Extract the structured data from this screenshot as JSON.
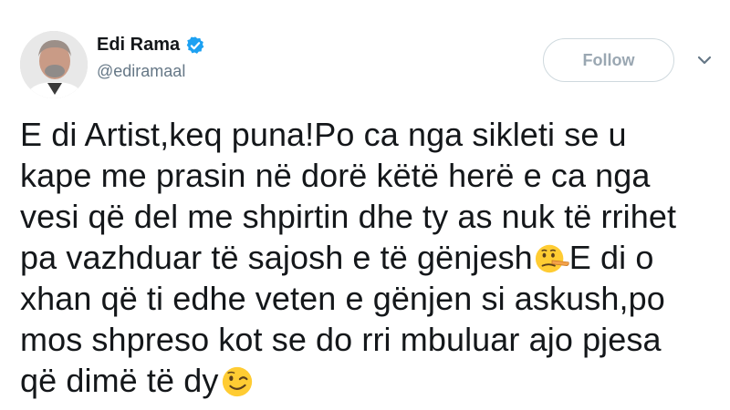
{
  "user": {
    "display_name": "Edi Rama",
    "handle": "@ediramaal"
  },
  "actions": {
    "follow_label": "Follow"
  },
  "tweet": {
    "lines": [
      "E di Artist,keq puna!Po ca nga sikleti se u",
      "kape me prasin në dorë këtë herë e ca nga",
      "vesi që del me shpirtin dhe ty as nuk të rrihet",
      "pa vazhduar të sajosh e të gënjesh",
      "E di o",
      "xhan që ti edhe veten e gënjen si askush,po",
      "mos shpreso kot se do rri mbuluar ajo pjesa",
      "që dimë të dy"
    ],
    "emojis": [
      "lying-face",
      "winking-face"
    ]
  },
  "colors": {
    "verified_blue": "#1da1f2",
    "follow_text": "#9aa7b2",
    "handle_text": "#657786"
  }
}
